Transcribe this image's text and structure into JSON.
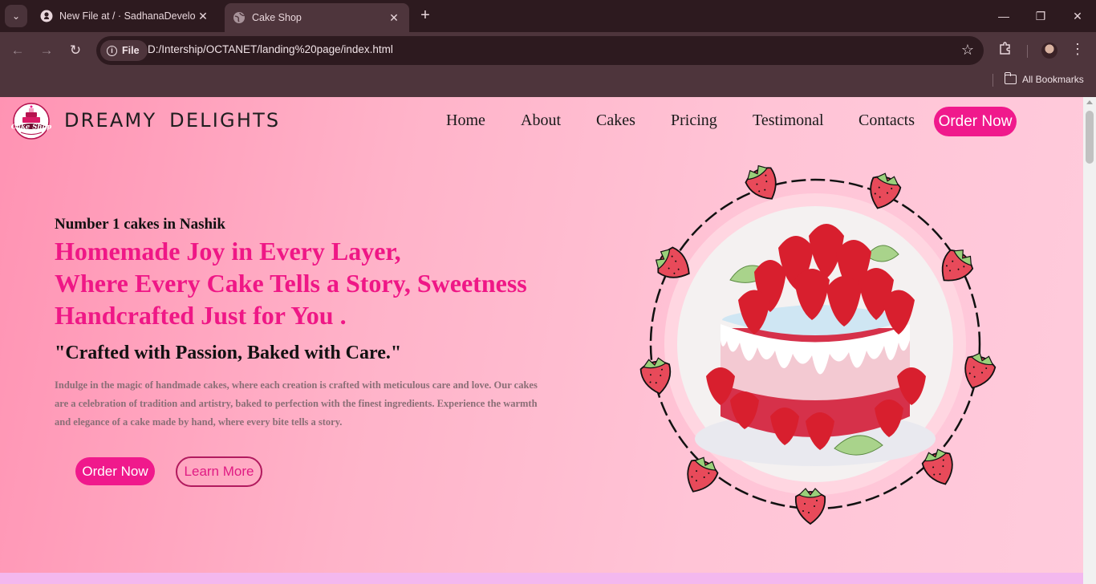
{
  "browser": {
    "tabs": [
      {
        "title": "New File at / · SadhanaDevelop"
      },
      {
        "title": "Cake Shop"
      }
    ],
    "address": {
      "scheme_chip": "File",
      "url": "D:/Intership/OCTANET/landing%20page/index.html"
    },
    "bookmarks_label": "All Bookmarks"
  },
  "site": {
    "brand": "DREAMY  DELIGHTS",
    "logo_text": "Cake Shop",
    "nav": [
      "Home",
      "About",
      "Cakes",
      "Pricing",
      "Testimonal",
      "Contacts"
    ],
    "order_now_top": "Order Now",
    "hero": {
      "tagline": "Number 1 cakes in Nashik",
      "headline": [
        "Homemade Joy in Every Layer,",
        "Where Every Cake Tells a Story, Sweetness",
        "Handcrafted Just for You ."
      ],
      "subheadline": "\"Crafted with Passion, Baked with Care.\"",
      "description": "Indulge in the magic of handmade cakes, where each creation is crafted with meticulous care and love. Our cakes are a celebration of tradition and artistry, baked to perfection with the finest ingredients. Experience the warmth and elegance of a cake made by hand, where every bite tells a story.",
      "order_button": "Order Now",
      "learn_button": "Learn More"
    }
  },
  "colors": {
    "accent_pink": "#f0198c",
    "headline_pink": "#ef1786",
    "chrome_dark": "#2d1a1f",
    "chrome_mid": "#4e353c"
  },
  "icons": {
    "tab_search": "chevron-down-icon",
    "github": "github-icon",
    "globe": "globe-icon",
    "back": "arrow-left-icon",
    "forward": "arrow-right-icon",
    "reload": "reload-icon",
    "info": "info-icon",
    "star": "star-icon",
    "extensions": "puzzle-icon",
    "profile": "avatar",
    "menu": "kebab-menu-icon",
    "folder": "folder-icon"
  }
}
